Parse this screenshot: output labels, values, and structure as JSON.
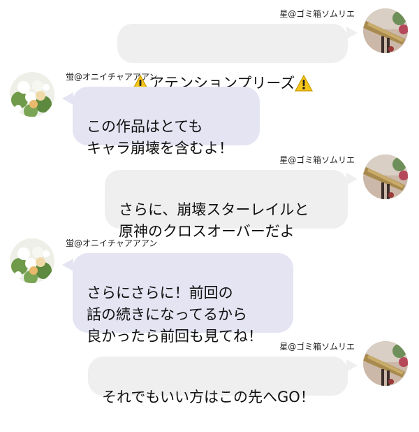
{
  "sender_right": {
    "name": "星@ゴミ箱ソムリエ",
    "avatar_icon": "telescope-photo-avatar"
  },
  "sender_left": {
    "name": "蛍@オニイチャアアアン",
    "avatar_icon": "flower-bouquet-avatar"
  },
  "messages": [
    {
      "side": "right",
      "sender": "星@ゴミ箱ソムリエ",
      "text": "アテンションプリーズ",
      "prefix_icon": "warning-icon",
      "suffix_icon": "warning-icon"
    },
    {
      "side": "left",
      "sender": "蛍@オニイチャアアアン",
      "text": "この作品はとても\nキャラ崩壊を含むよ！"
    },
    {
      "side": "right",
      "sender": "星@ゴミ箱ソムリエ",
      "text": "さらに、崩壊スターレイルと\n原神のクロスオーバーだよ"
    },
    {
      "side": "left",
      "sender": "蛍@オニイチャアアアン",
      "text": "さらにさらに！前回の\n話の続きになってるから\n良かったら前回も見てね！"
    },
    {
      "side": "right",
      "sender": "星@ゴミ箱ソムリエ",
      "text": "それでもいい方はこの先へGO！"
    }
  ],
  "colors": {
    "bubble_right": "#efefef",
    "bubble_left": "#e4e4f3",
    "warning_yellow": "#f5c518"
  }
}
